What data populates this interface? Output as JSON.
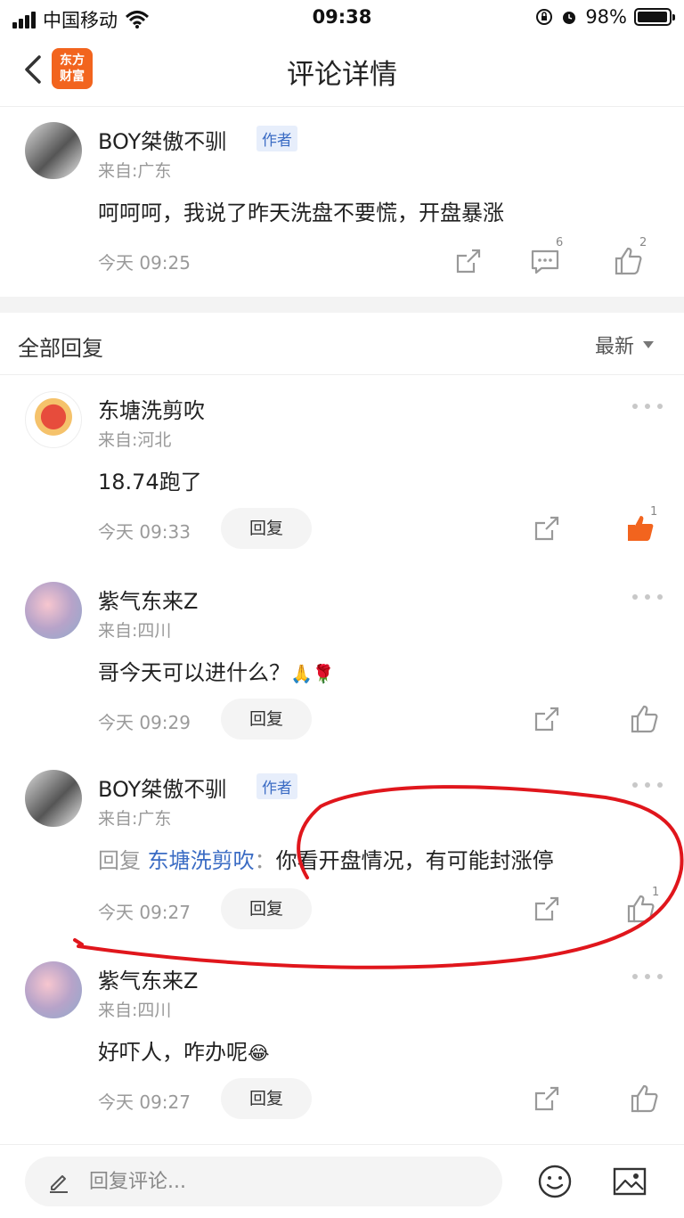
{
  "status_bar": {
    "carrier": "中国移动",
    "time": "09:38",
    "battery_text": "98%",
    "battery_level": 0.98
  },
  "nav": {
    "title": "评论详情",
    "logo_line1": "东方",
    "logo_line2": "财富"
  },
  "main_comment": {
    "username": "BOY桀傲不驯",
    "badge": "作者",
    "location": "来自:广东",
    "text": "呵呵呵，我说了昨天洗盘不要慌，开盘暴涨",
    "time": "今天 09:25",
    "reply_count": "6",
    "like_count": "2"
  },
  "section": {
    "title": "全部回复",
    "sort_label": "最新"
  },
  "replies": [
    {
      "username": "东塘洗剪吹",
      "location": "来自:河北",
      "text": "18.74跑了",
      "time": "今天 09:33",
      "reply_label": "回复",
      "like_count": "1",
      "liked": true
    },
    {
      "username": "紫气东来Z",
      "location": "来自:四川",
      "text": "哥今天可以进什么？",
      "emoji": "🙏🌹",
      "time": "今天 09:29",
      "reply_label": "回复",
      "like_count": "",
      "liked": false
    },
    {
      "username": "BOY桀傲不驯",
      "badge": "作者",
      "location": "来自:广东",
      "reply_prefix": "回复",
      "reply_target": "东塘洗剪吹",
      "reply_colon": "：",
      "text": "你看开盘情况，有可能封涨停",
      "time": "今天 09:27",
      "reply_label": "回复",
      "like_count": "1",
      "liked": false
    },
    {
      "username": "紫气东来Z",
      "location": "来自:四川",
      "text": "好吓人，咋办呢",
      "emoji": "😂",
      "time": "今天 09:27",
      "reply_label": "回复",
      "like_count": "",
      "liked": false
    }
  ],
  "bottom_bar": {
    "placeholder": "回复评论..."
  },
  "colors": {
    "accent_orange": "#f2641e",
    "link_blue": "#3b6cc4",
    "annotation_red": "#e0161c"
  },
  "icons": [
    "back-arrow-icon",
    "share-icon",
    "comment-icon",
    "thumb-up-icon",
    "more-dots-icon",
    "pen-icon",
    "emoji-icon",
    "image-icon",
    "wifi-icon",
    "signal-icon",
    "battery-icon",
    "alarm-icon",
    "lock-rotation-icon"
  ]
}
